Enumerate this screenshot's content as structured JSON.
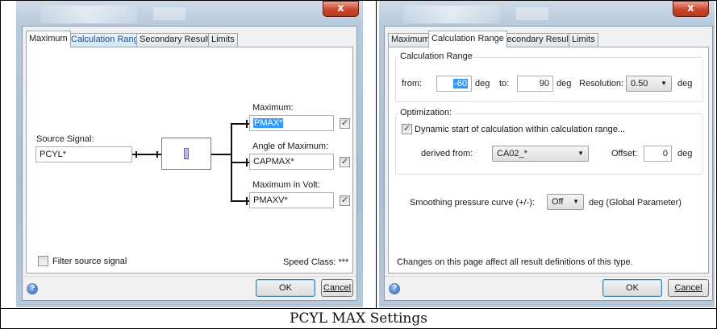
{
  "caption": "PCYL MAX Settings",
  "left_dialog": {
    "close_glyph": "x",
    "tabs": [
      "Maximum",
      "Calculation Range",
      "Secondary Results",
      "Limits"
    ],
    "source_signal_label": "Source Signal:",
    "source_signal_value": "PCYL*",
    "maximum_label": "Maximum:",
    "maximum_value": "PMAX*",
    "angle_label": "Angle of Maximum:",
    "angle_value": "CAPMAX*",
    "volt_label": "Maximum in Volt:",
    "volt_value": "PMAXV*",
    "check_mark": "✓",
    "filter_label": "Filter source signal",
    "speed_class": "Speed Class: ***",
    "help_glyph": "?",
    "ok_label": "OK",
    "cancel_label": "Cancel"
  },
  "right_dialog": {
    "close_glyph": "x",
    "tabs": [
      "Maximum",
      "Calculation Range",
      "Secondary Results",
      "Limits"
    ],
    "calc_range_title": "Calculation Range",
    "from_label": "from:",
    "from_value": "-60",
    "deg1": "deg",
    "to_label": "to:",
    "to_value": "90",
    "deg2": "deg",
    "resolution_label": "Resolution:",
    "resolution_value": "0.50",
    "deg3": "deg",
    "optimization_title": "Optimization:",
    "dynamic_label": "Dynamic start of calculation within calculation range...",
    "check_mark": "✓",
    "derived_from_label": "derived from:",
    "derived_from_value": "CA02_*",
    "offset_label": "Offset:",
    "offset_value": "0",
    "deg4": "deg",
    "smoothing_label": "Smoothing pressure curve (+/-):",
    "smoothing_value": "Off",
    "smoothing_unit": "deg (Global Parameter)",
    "footer_note": "Changes on this page affect all result definitions of this type.",
    "help_glyph": "?",
    "ok_label": "OK",
    "cancel_label": "Cancel"
  }
}
